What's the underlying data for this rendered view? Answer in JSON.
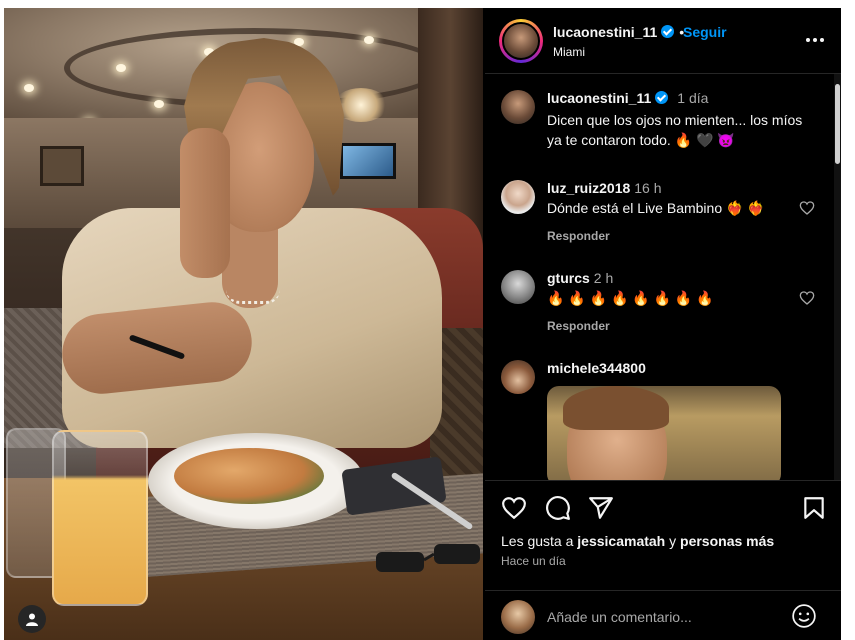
{
  "post": {
    "username": "lucaonestini_11",
    "follow_label": "Seguir",
    "separator": "•",
    "location": "Miami",
    "more_icon": "more-horizontal-icon"
  },
  "comments": [
    {
      "username": "lucaonestini_11",
      "time": "1 día",
      "text": "Dicen que los ojos no mienten... los míos ya te contaron todo. 🔥 🖤 👿",
      "verified": true
    },
    {
      "username": "luz_ruiz2018",
      "time": "16 h",
      "text": "Dónde está el Live Bambino ❤️‍🔥 ❤️‍🔥",
      "reply_label": "Responder"
    },
    {
      "username": "gturcs",
      "time": "2 h",
      "text": "🔥 🔥 🔥 🔥 🔥 🔥 🔥 🔥",
      "reply_label": "Responder"
    },
    {
      "username": "michele344800",
      "time": "",
      "text": ""
    }
  ],
  "actions": {
    "likes_prefix": "Les gusta a ",
    "likes_user": "jessicamatah",
    "likes_mid": " y ",
    "likes_others": "personas más",
    "time_ago": "Hace un día"
  },
  "add_comment": {
    "placeholder": "Añade un comentario..."
  },
  "colors": {
    "accent": "#0095f6",
    "background": "#000000",
    "text": "#f5f5f5",
    "muted": "#a8a8a8"
  }
}
